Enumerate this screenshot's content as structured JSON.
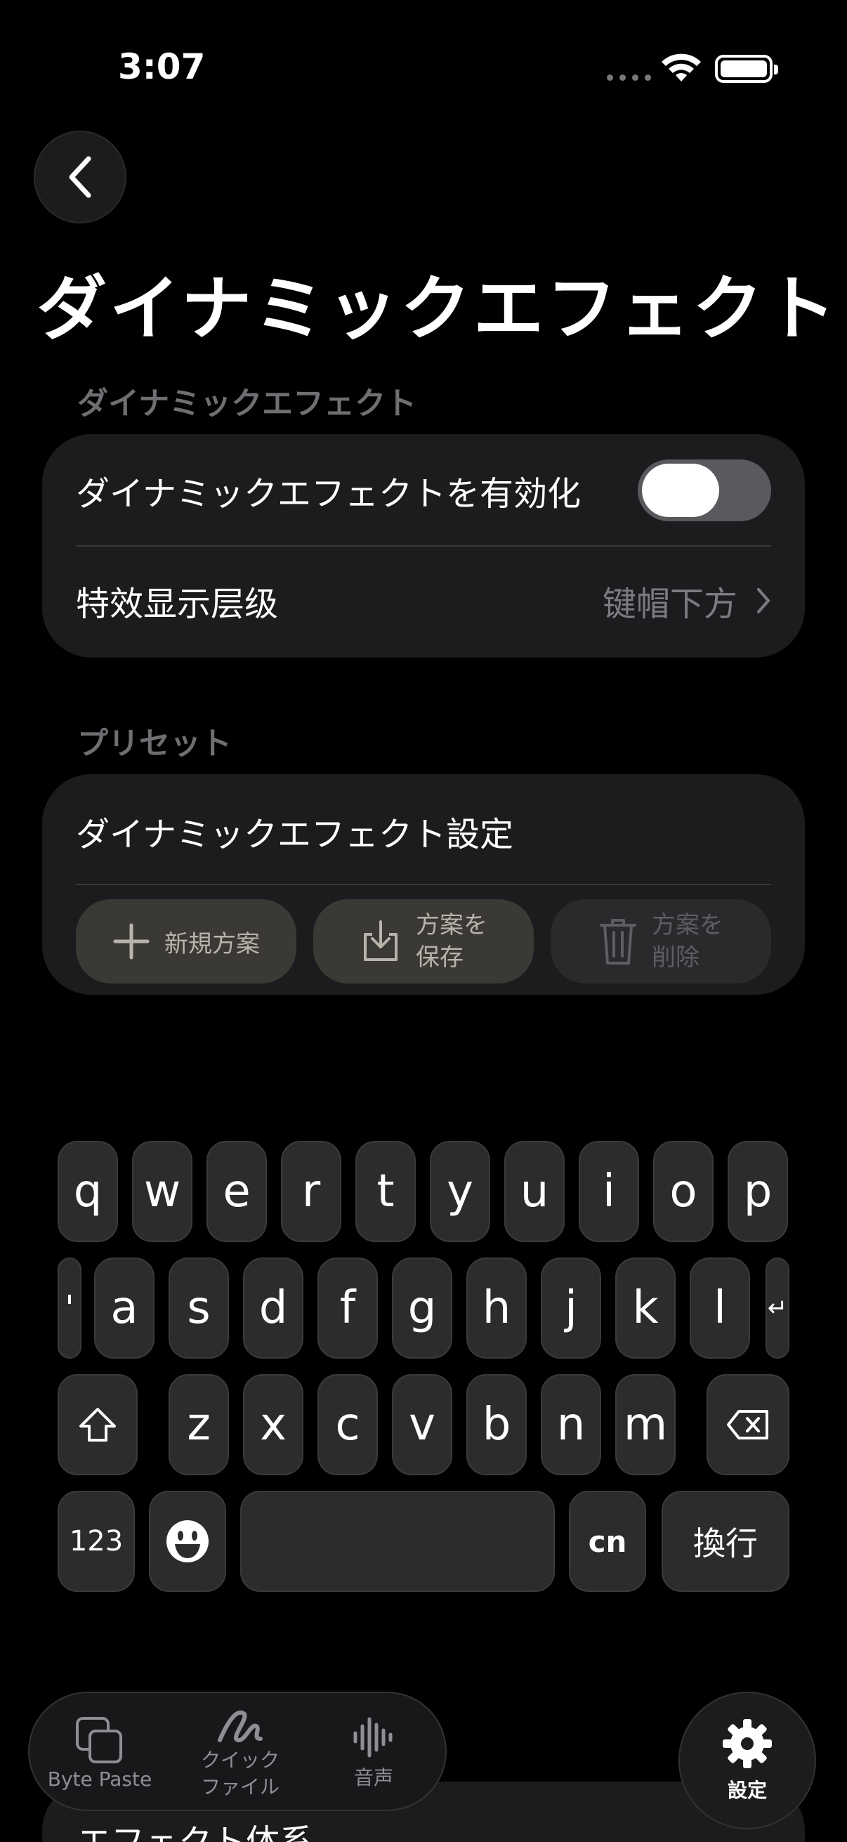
{
  "status": {
    "time": "3:07"
  },
  "page": {
    "title": "ダイナミックエフェクト"
  },
  "sections": {
    "effects": {
      "header": "ダイナミックエフェクト",
      "enable_label": "ダイナミックエフェクトを有効化",
      "enable_on": false,
      "layer_label": "特效显示层级",
      "layer_value": "键帽下方"
    },
    "presets": {
      "header": "プリセット",
      "current_name": "ダイナミックエフェクト設定",
      "new_label": "新規方案",
      "save_label_1": "方案を",
      "save_label_2": "保存",
      "delete_label_1": "方案を",
      "delete_label_2": "削除"
    }
  },
  "keyboard": {
    "row1": [
      "q",
      "w",
      "e",
      "r",
      "t",
      "y",
      "u",
      "i",
      "o",
      "p"
    ],
    "row2": [
      "a",
      "s",
      "d",
      "f",
      "g",
      "h",
      "j",
      "k",
      "l"
    ],
    "row3": [
      "z",
      "x",
      "c",
      "v",
      "b",
      "n",
      "m"
    ],
    "apostrophe": "'",
    "return_small": "↵",
    "numbers": "123",
    "lang": "cn",
    "newline": "換行"
  },
  "tabbar": {
    "byte_paste": "Byte Paste",
    "quick_file_1": "クイック",
    "quick_file_2": "ファイル",
    "voice": "音声",
    "settings": "設定"
  },
  "behind": {
    "label": "エフェクト体系"
  }
}
